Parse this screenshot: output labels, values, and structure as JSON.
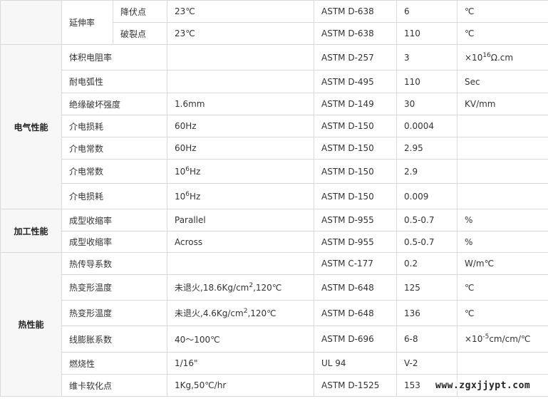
{
  "rows": [
    {
      "sub": "降伏点",
      "cond": "23℃",
      "method": "ASTM D-638",
      "value": "6",
      "unit": "℃"
    },
    {
      "sub": "破裂点",
      "cond": "23℃",
      "method": "ASTM D-638",
      "value": "110",
      "unit": "℃"
    },
    {
      "prop": "体积电阻率",
      "cond": "",
      "method": "ASTM D-257",
      "value": "3",
      "unit_pre": "×10",
      "unit_sup": "16",
      "unit_post": "Ω.cm"
    },
    {
      "prop": "耐电弧性",
      "cond": "",
      "method": "ASTM D-495",
      "value": "110",
      "unit": "Sec"
    },
    {
      "prop": "绝缘破坏强度",
      "cond": "1.6mm",
      "method": "ASTM D-149",
      "value": "30",
      "unit": "KV/mm"
    },
    {
      "prop": "介电损耗",
      "cond": "60Hz",
      "method": "ASTM D-150",
      "value": "0.0004",
      "unit": ""
    },
    {
      "prop": "介电常数",
      "cond": "60Hz",
      "method": "ASTM D-150",
      "value": "2.95",
      "unit": ""
    },
    {
      "prop": "介电常数",
      "cond_pre": "10",
      "cond_sup": "6",
      "cond_post": "Hz",
      "method": "ASTM D-150",
      "value": "2.9",
      "unit": ""
    },
    {
      "prop": "介电损耗",
      "cond_pre": "10",
      "cond_sup": "6",
      "cond_post": "Hz",
      "method": "ASTM D-150",
      "value": "0.009",
      "unit": ""
    },
    {
      "prop": "成型收缩率",
      "cond": "Parallel",
      "method": "ASTM D-955",
      "value": "0.5-0.7",
      "unit": "%"
    },
    {
      "prop": "成型收缩率",
      "cond": "Across",
      "method": "ASTM D-955",
      "value": "0.5-0.7",
      "unit": "%"
    },
    {
      "prop": "热传导系数",
      "cond": "",
      "method": "ASTM C-177",
      "value": "0.2",
      "unit": "W/m℃"
    },
    {
      "prop": "热变形温度",
      "cond_pre": "未退火,18.6Kg/cm",
      "cond_sup": "2",
      "cond_post": ",120℃",
      "method": "ASTM D-648",
      "value": "125",
      "unit": "℃"
    },
    {
      "prop": "热变形温度",
      "cond_pre": "未退火,4.6Kg/cm",
      "cond_sup": "2",
      "cond_post": ",120℃",
      "method": "ASTM D-648",
      "value": "136",
      "unit": "℃"
    },
    {
      "prop": "线膨胀系数",
      "cond": "40～100℃",
      "method": "ASTM D-696",
      "value": "6-8",
      "unit_pre": "×10",
      "unit_sup": "-5",
      "unit_post": "cm/cm/℃"
    },
    {
      "prop": "燃烧性",
      "cond": "1/16\"",
      "method": "UL 94",
      "value": "V-2",
      "unit": ""
    },
    {
      "prop": "维卡软化点",
      "cond": "1Kg,50℃/hr",
      "method": "ASTM D-1525",
      "value": "153",
      "unit": ""
    }
  ],
  "groups": {
    "elongation": "延伸率",
    "electrical": "电气性能",
    "processing": "加工性能",
    "thermal": "热性能"
  },
  "watermark": "www.zgxjjypt.com"
}
